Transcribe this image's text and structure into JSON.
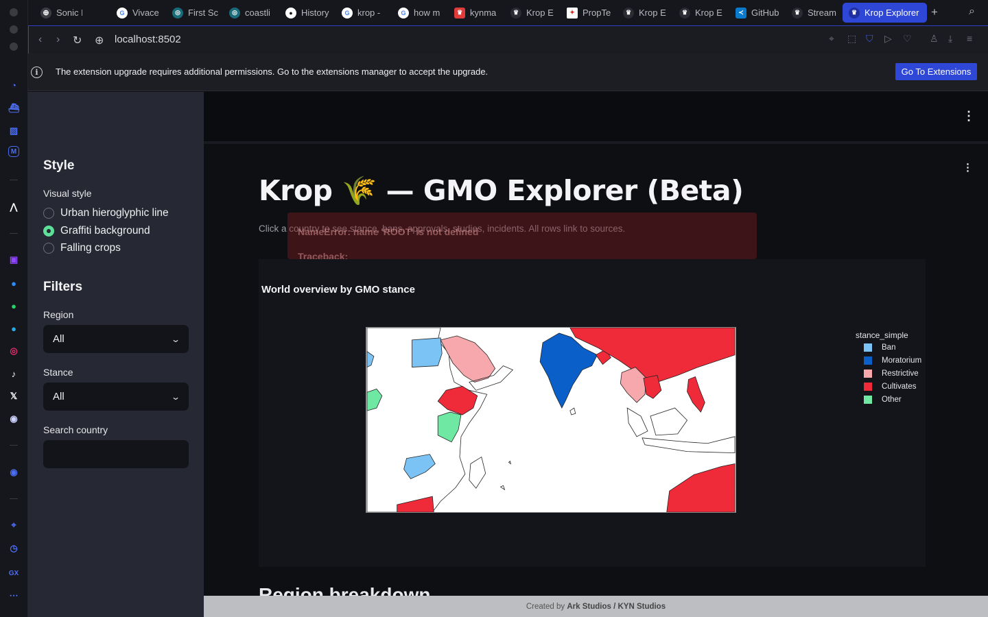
{
  "browser": {
    "tabs": [
      {
        "label": "Sonic F",
        "icon": "globe-icon"
      },
      {
        "label": "Vivace",
        "icon": "google-icon"
      },
      {
        "label": "First Sc",
        "icon": "circle-app-icon"
      },
      {
        "label": "coastli",
        "icon": "circle-app-icon"
      },
      {
        "label": "History",
        "icon": "github-icon"
      },
      {
        "label": "krop -",
        "icon": "google-icon"
      },
      {
        "label": "how m",
        "icon": "google-icon"
      },
      {
        "label": "kynma",
        "icon": "crown-icon"
      },
      {
        "label": "Krop E",
        "icon": "crown-icon"
      },
      {
        "label": "PropTe",
        "icon": "maple-leaf-icon"
      },
      {
        "label": "Krop E",
        "icon": "crown-icon"
      },
      {
        "label": "Krop E",
        "icon": "crown-icon"
      },
      {
        "label": "GitHub",
        "icon": "vscode-icon"
      },
      {
        "label": "Stream",
        "icon": "crown-icon"
      },
      {
        "label": "Krop Explorer",
        "icon": "crown-icon"
      }
    ],
    "url": "localhost:8502",
    "info_message": "The extension upgrade requires additional permissions. Go to the extensions manager to accept the upgrade.",
    "info_button": "Go To Extensions"
  },
  "sidebar": {
    "style_heading": "Style",
    "visual_style_label": "Visual style",
    "visual_styles": [
      {
        "label": "Urban hieroglyphic line",
        "selected": false
      },
      {
        "label": "Graffiti background",
        "selected": true
      },
      {
        "label": "Falling crops",
        "selected": false
      }
    ],
    "filters_heading": "Filters",
    "region_label": "Region",
    "region_value": "All",
    "stance_label": "Stance",
    "stance_value": "All",
    "search_label": "Search country",
    "search_value": ""
  },
  "main": {
    "title": "Krop 🌾 — GMO Explorer (Beta)",
    "subtitle": "Click a country to see stance, bans, approvals, studies, incidents. All rows link to sources.",
    "error_line": "NameError: name 'ROOT' is not defined",
    "error_traceback": "Traceback:",
    "chart_title": "World overview by GMO stance",
    "legend_title": "stance_simple",
    "legend": [
      {
        "label": "Ban",
        "color": "#7cc3f5"
      },
      {
        "label": "Moratorium",
        "color": "#0b5fc9"
      },
      {
        "label": "Restrictive",
        "color": "#f6a8ac"
      },
      {
        "label": "Cultivates",
        "color": "#ef2b3a"
      },
      {
        "label": "Other",
        "color": "#6ee8a2"
      }
    ],
    "next_section": "Region breakdown",
    "footer_prefix": "Created by ",
    "footer_credit": "Ark Studios / KYN Studios"
  }
}
